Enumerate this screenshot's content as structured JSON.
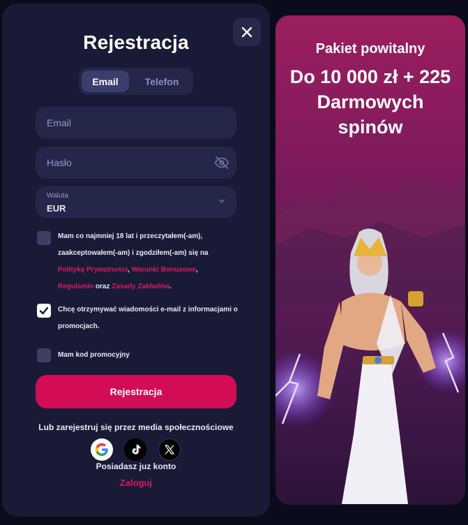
{
  "form": {
    "title": "Rejestracja",
    "tabs": [
      {
        "label": "Email",
        "active": true
      },
      {
        "label": "Telefon",
        "active": false
      }
    ],
    "email_placeholder": "Email",
    "password_placeholder": "Hasło",
    "currency_label": "Waluta",
    "currency_value": "EUR",
    "consent": {
      "line1": "Mam co najmniej 18 lat i przeczytałem(-am),",
      "line2": "zaakceptowałem(-am) i zgodziłem(-am) się na",
      "privacy_link": "Politykę Prywatności",
      "comma": ",",
      "bonus_link": "Warunki Bonusowe",
      "comma2": ",",
      "terms_link": "Regulamin",
      "and": "oraz",
      "betting_link": "Zasady Zakładów",
      "period": ".",
      "checked": false
    },
    "newsletter": {
      "text": "Chcę otrzymywać wiadomości e-mail z informacjami o promocjach.",
      "checked": true
    },
    "promo_code": {
      "text": "Mam kod promocyjny",
      "checked": false
    },
    "submit_label": "Rejestracja",
    "social_title": "Lub zarejestruj się przez media społecznościowe",
    "social_icons": [
      "google-icon",
      "tiktok-icon",
      "x-icon"
    ],
    "have_account": "Posiadasz juz konto",
    "login_link": "Zaloguj"
  },
  "promo": {
    "subtitle": "Pakiet powitalny",
    "headline": "Do 10 000 zł + 225 Darmowych spinów"
  },
  "colors": {
    "accent": "#d20c55",
    "panel": "#191a36",
    "field": "#24264a"
  }
}
